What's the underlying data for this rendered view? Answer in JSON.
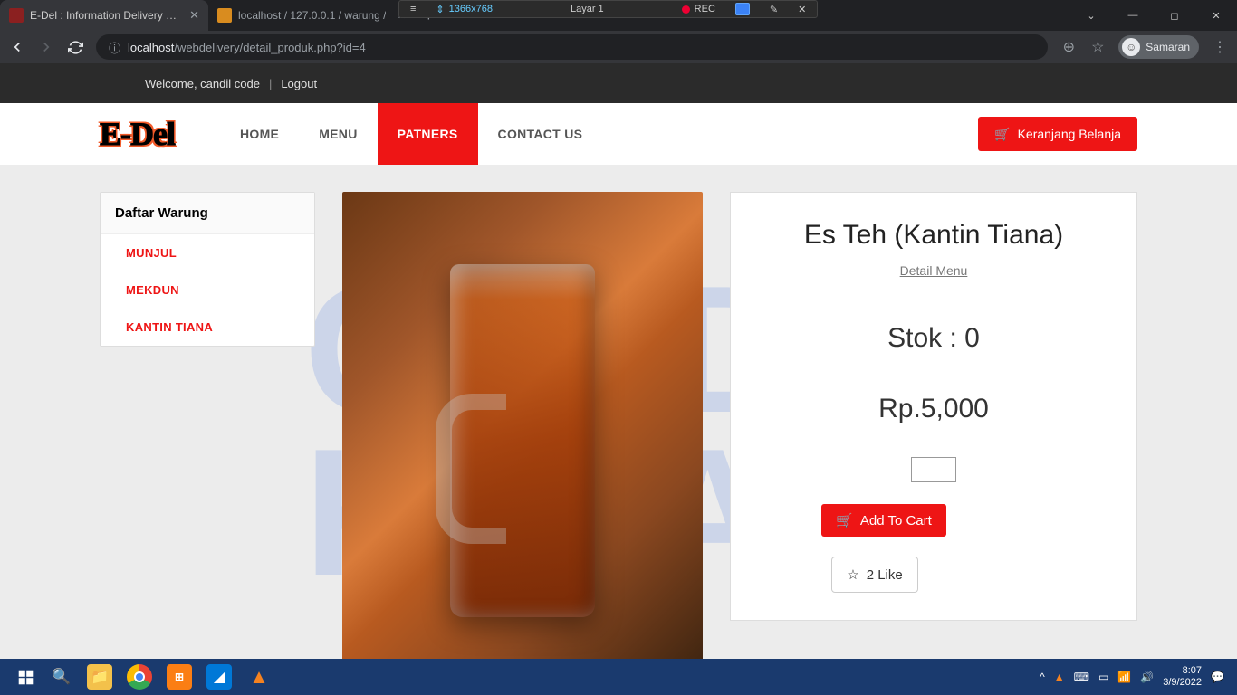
{
  "browser": {
    "tabs": [
      {
        "title": "E-Del : Information Delivery Orde",
        "active": true
      },
      {
        "title": "localhost / 127.0.0.1 / warung /",
        "active": false
      }
    ],
    "url_prefix": "localhost",
    "url_path": "/webdelivery/detail_produk.php?id=4",
    "profile_name": "Samaran"
  },
  "recorder": {
    "resolution": "1366x768",
    "screen_label": "Layar 1",
    "rec_label": "REC"
  },
  "welcome": {
    "greeting": "Welcome, candil code",
    "logout": "Logout"
  },
  "header": {
    "logo": "E-Del",
    "nav": [
      {
        "label": "HOME",
        "active": false
      },
      {
        "label": "MENU",
        "active": false
      },
      {
        "label": "PATNERS",
        "active": true
      },
      {
        "label": "CONTACT US",
        "active": false
      }
    ],
    "cart_button": "Keranjang Belanja"
  },
  "sidebar": {
    "title": "Daftar Warung",
    "items": [
      {
        "label": "MUNJUL"
      },
      {
        "label": "MEKDUN"
      },
      {
        "label": "KANTIN TIANA"
      }
    ]
  },
  "product": {
    "title": "Es Teh (Kantin Tiana)",
    "detail_link": "Detail Menu",
    "stock_label": "Stok : 0",
    "price": "Rp.5,000",
    "add_to_cart": "Add To Cart",
    "like_label": "2 Like"
  },
  "watermark": {
    "line1": "CANDIL",
    "line2": "KUYA"
  },
  "taskbar": {
    "time": "8:07",
    "date": "3/9/2022"
  }
}
